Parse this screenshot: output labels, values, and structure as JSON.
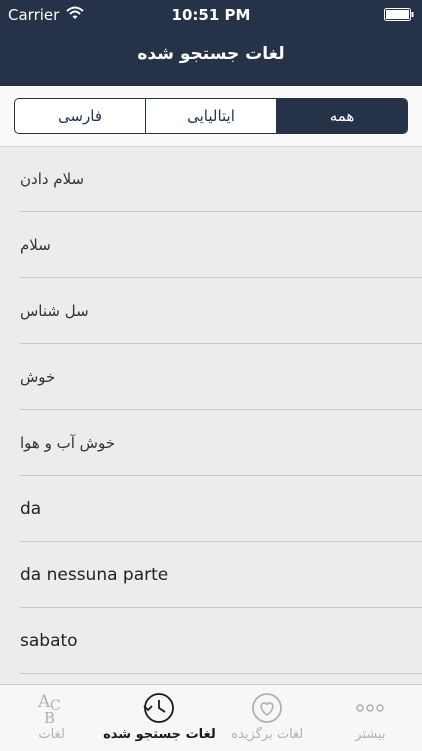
{
  "status_bar": {
    "carrier": "Carrier",
    "time": "10:51 PM"
  },
  "nav": {
    "title": "لغات جستجو شده"
  },
  "segments": [
    {
      "label": "فارسی",
      "active": false
    },
    {
      "label": "ایتالیایی",
      "active": false
    },
    {
      "label": "همه",
      "active": true
    }
  ],
  "list": [
    "سلام دادن",
    "سلام",
    "سل شناس",
    "خوش",
    "خوش آب و هوا",
    "da",
    "da nessuna parte",
    "sabato"
  ],
  "tabs": [
    {
      "label": "لغات",
      "icon": "abc-icon",
      "active": false
    },
    {
      "label": "لغات جستجو شده",
      "icon": "history-icon",
      "active": true
    },
    {
      "label": "لغات برگزیده",
      "icon": "heart-icon",
      "active": false
    },
    {
      "label": "بیشتر",
      "icon": "more-icon",
      "active": false
    }
  ],
  "colors": {
    "header_bg": "#263248",
    "list_bg": "#ececec",
    "inactive_tab": "#b0b0b0"
  }
}
